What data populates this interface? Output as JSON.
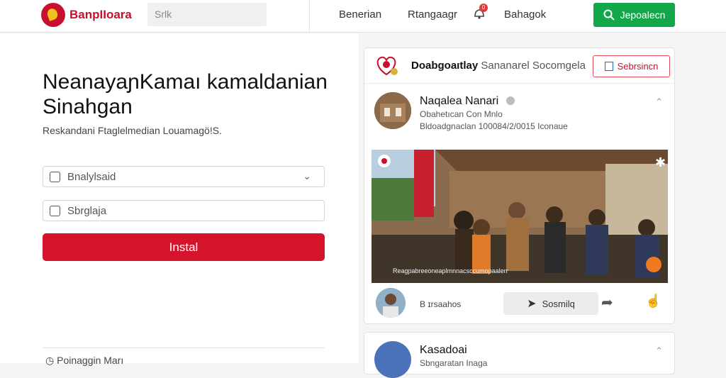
{
  "topbar": {
    "brand": "BanpIIoara",
    "search_placeholder": "Srlk",
    "nav": [
      "Benerian",
      "Rtangaagr",
      "Bahagok"
    ],
    "notification_count": "0",
    "cta_label": "Jepoalecn"
  },
  "hero": {
    "heading": "NeanayaɲKamaı kamaldanian Sinahgan",
    "subtext": "Reskandani Ftaglelmedian Louamagö!S.",
    "field1": "Bnalylsaid",
    "field2": "Sbrglaja",
    "submit_label": "Instal",
    "footer_item": "Poinaggin Marı"
  },
  "feed_card": {
    "title_bold": "Doabgoaıtlay",
    "title_rest": "Sananarel Socomgela",
    "action_label": "Sebrsincn",
    "post": {
      "name": "Naqalea Nanari",
      "meta1": "Obahetıcan  Con                Mnlo",
      "meta2": "Bldoadgnaclan 100084/2/0015 Iconaue",
      "caption": "Reagpabreeoneaplmnnacsccumopaalerr",
      "comment_label": "B ɪrsaahos",
      "share_label": "Sosmilq"
    },
    "colors": {
      "accent": "#c8102e",
      "green": "#12a84a"
    }
  },
  "second_card": {
    "name": "Kasadoai",
    "meta": "Sbngaratan Inaga"
  }
}
